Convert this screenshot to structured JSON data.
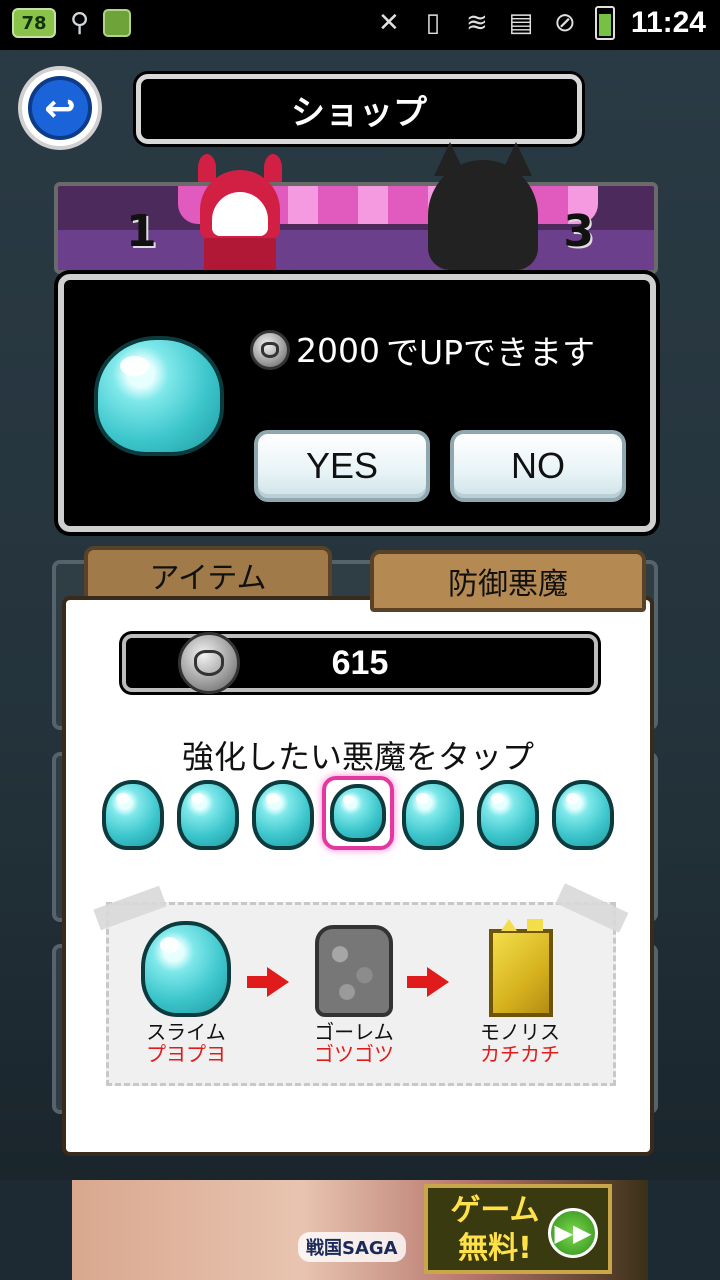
{
  "status_bar": {
    "battery_badge": "78",
    "usb_icon": "usb-icon",
    "time": "11:24"
  },
  "header": {
    "title": "ショップ",
    "back_icon": "back-arrow-icon"
  },
  "stage": {
    "left_number": "1",
    "right_number": "3"
  },
  "popup": {
    "cost": "2000",
    "message": "でUPできます",
    "yes_label": "YES",
    "no_label": "NO"
  },
  "tabs": {
    "items_label": "アイテム",
    "defense_label": "防御悪魔"
  },
  "panel": {
    "coins": "615",
    "instruction": "強化したい悪魔をタップ",
    "slots": [
      {
        "selected": false
      },
      {
        "selected": false
      },
      {
        "selected": false
      },
      {
        "selected": true
      },
      {
        "selected": false
      },
      {
        "selected": false
      },
      {
        "selected": false
      }
    ],
    "evolution": [
      {
        "name": "スライム",
        "sub": "プヨプヨ"
      },
      {
        "name": "ゴーレム",
        "sub": "ゴツゴツ"
      },
      {
        "name": "モノリス",
        "sub": "カチカチ"
      }
    ]
  },
  "ad": {
    "logo_text": "戦国SAGA",
    "cta_text": "ゲーム無料!"
  },
  "colors": {
    "slime": "#3cc6cc",
    "selected_border": "#e2389f",
    "evo_sub_text": "#e11b1b",
    "tab_brown": "#a07a48"
  }
}
